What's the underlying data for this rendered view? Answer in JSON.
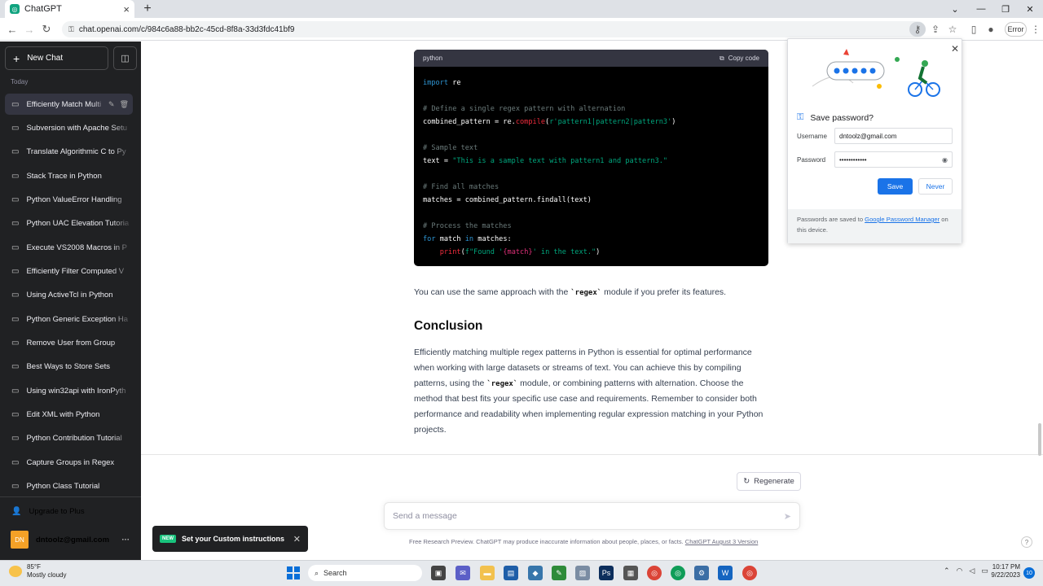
{
  "browser": {
    "tab_title": "ChatGPT",
    "url": "chat.openai.com/c/984c6a88-bb2c-45cd-8f8a-33d3fdc41bf9",
    "error_label": "Error"
  },
  "sidebar": {
    "new_chat": "New Chat",
    "section_today": "Today",
    "conversations": [
      "Efficiently Match Multi",
      "Subversion with Apache Setu",
      "Translate Algorithmic C to Py",
      "Stack Trace in Python",
      "Python ValueError Handling",
      "Python UAC Elevation Tutoria",
      "Execute VS2008 Macros in P",
      "Efficiently Filter Computed V",
      "Using ActiveTcl in Python",
      "Python Generic Exception Ha",
      "Remove User from Group",
      "Best Ways to Store Sets",
      "Using win32api with IronPyth",
      "Edit XML with Python",
      "Python Contribution Tutorial",
      "Capture Groups in Regex",
      "Python Class Tutorial"
    ],
    "upgrade": "Upgrade to Plus",
    "user_initials": "DN",
    "user_email": "dntoolz@gmail.com"
  },
  "code": {
    "language": "python",
    "copy_label": "Copy code"
  },
  "content": {
    "note_before": "You can use the same approach with the ",
    "note_code": "`regex`",
    "note_after": " module if you prefer its features.",
    "heading": "Conclusion",
    "para_1": "Efficiently matching multiple regex patterns in Python is essential for optimal performance when working with large datasets or streams of text. You can achieve this by compiling patterns, using the ",
    "para_code": "`regex`",
    "para_2": " module, or combining patterns with alternation. Choose the method that best fits your specific use case and requirements. Remember to consider both performance and readability when implementing regular expression matching in your Python projects."
  },
  "composer": {
    "regenerate": "Regenerate",
    "placeholder": "Send a message",
    "disclaimer": "Free Research Preview. ChatGPT may produce inaccurate information about people, places, or facts. ",
    "version_link": "ChatGPT August 3 Version"
  },
  "toast": {
    "badge": "NEW",
    "text": "Set your Custom instructions"
  },
  "password_popup": {
    "title": "Save password?",
    "username_label": "Username",
    "username_value": "dntoolz@gmail.com",
    "password_label": "Password",
    "password_value": "••••••••••••",
    "save": "Save",
    "never": "Never",
    "footer_pre": "Passwords are saved to ",
    "footer_link": "Google Password Manager",
    "footer_post": " on this device."
  },
  "taskbar": {
    "temperature": "85°F",
    "condition": "Mostly cloudy",
    "search": "Search",
    "time": "10:17 PM",
    "date": "9/22/2023",
    "notif_count": "10"
  },
  "colors": {
    "sidebar_bg": "#202123",
    "accent_green": "#19c37d",
    "chrome_blue": "#1a73e8"
  }
}
